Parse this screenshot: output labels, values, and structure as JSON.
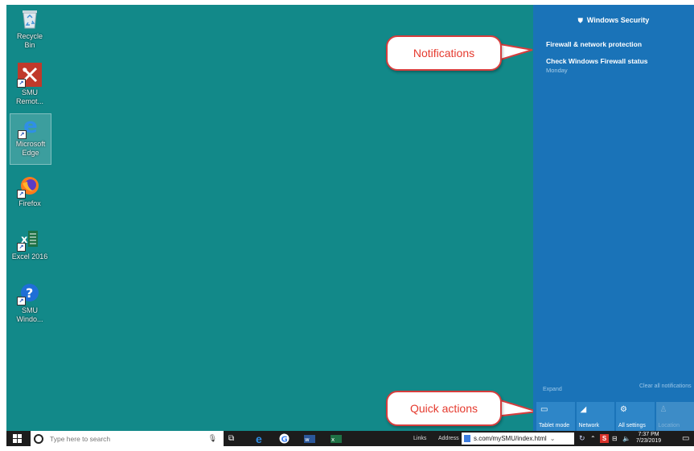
{
  "desktop": {
    "icons": [
      {
        "label": "Recycle\nBin"
      },
      {
        "label": "SMU\nRemot..."
      },
      {
        "label": "Microsoft\nEdge"
      },
      {
        "label": "Firefox"
      },
      {
        "label": "Excel 2016"
      },
      {
        "label": "SMU\nWindo..."
      }
    ]
  },
  "action_center": {
    "header": "Windows Security",
    "notifications": [
      {
        "text": "Firewall & network protection"
      },
      {
        "text": "Check Windows Firewall status",
        "time": "Monday"
      }
    ],
    "expand_label": "Expand",
    "clear_all_label": "Clear all notifications",
    "quick_actions": [
      {
        "label": "Tablet mode",
        "icon": "tablet-icon"
      },
      {
        "label": "Network",
        "icon": "network-icon"
      },
      {
        "label": "All settings",
        "icon": "gear-icon"
      },
      {
        "label": "Location",
        "icon": "location-icon"
      }
    ]
  },
  "callouts": {
    "notifications": "Notifications",
    "quick_actions": "Quick actions"
  },
  "taskbar": {
    "search_placeholder": "Type here to search",
    "links_label": "Links",
    "address_label": "Address",
    "address_value": "s.com/mySMU/index.html",
    "time": "7:37 PM",
    "date": "7/23/2019"
  },
  "colors": {
    "desktop": "#128989",
    "action_center": "#1a73b8",
    "callout_border": "#d63d3d",
    "callout_text": "#e53a2e"
  }
}
